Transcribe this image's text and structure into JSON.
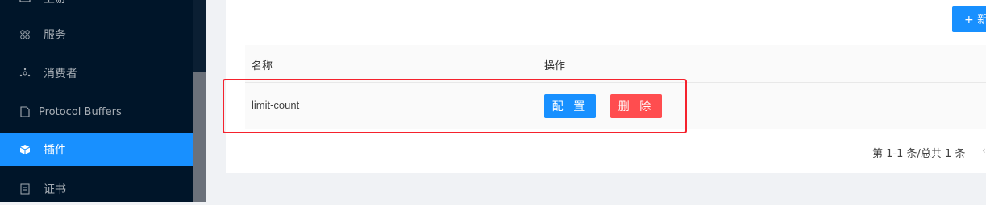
{
  "sidebar": {
    "items": [
      {
        "label": "上游",
        "icon": "gateway-icon"
      },
      {
        "label": "服务",
        "icon": "service-icon"
      },
      {
        "label": "消费者",
        "icon": "consumer-icon"
      },
      {
        "label": "Protocol Buffers",
        "icon": "file-icon"
      },
      {
        "label": "插件",
        "icon": "plugin-icon",
        "active": true
      },
      {
        "label": "证书",
        "icon": "certificate-icon"
      }
    ]
  },
  "toolbar": {
    "add_label": "+ 新"
  },
  "table": {
    "columns": [
      "名称",
      "操作"
    ],
    "rows": [
      {
        "name": "limit-count",
        "config_label": "配 置",
        "delete_label": "删 除"
      }
    ]
  },
  "pagination": {
    "summary": "第 1-1 条/总共 1 条",
    "prev_icon": "‹"
  },
  "colors": {
    "primary": "#1890ff",
    "danger": "#ff4d4f",
    "sidebar_bg": "#001529",
    "highlight": "#f5222d"
  }
}
